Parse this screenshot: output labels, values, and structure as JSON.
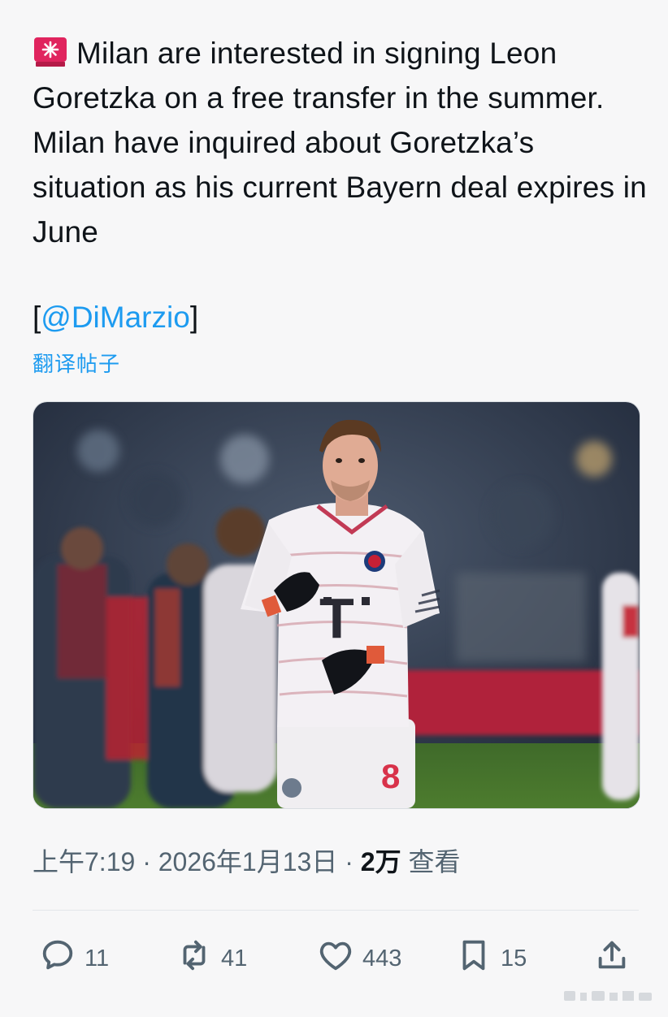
{
  "tweet": {
    "text": "Milan are interested in signing Leon Goretzka on a free transfer in the summer. Milan have inquired about Goretzka’s situation as his current Bayern deal expires in June",
    "mention_open": "[",
    "mention": "@DiMarzio",
    "mention_close": "]",
    "translate_label": "翻译帖子",
    "meta": {
      "time": "上午7:19",
      "separator1": " · ",
      "date": "2026年1月13日",
      "separator2": " · ",
      "views_count": "2万",
      "views_label": " 查看"
    }
  },
  "photo": {
    "jersey_number": "8",
    "jersey_sponsor_glyph": "T"
  },
  "actions": {
    "reply_count": "11",
    "retweet_count": "41",
    "like_count": "443",
    "bookmark_count": "15"
  },
  "colors": {
    "accent": "#1d9bf0",
    "text": "#0f1419",
    "secondary": "#536471",
    "siren_red": "#e0245e"
  },
  "icons": [
    "siren-icon",
    "reply-icon",
    "retweet-icon",
    "like-icon",
    "bookmark-icon",
    "share-icon"
  ]
}
